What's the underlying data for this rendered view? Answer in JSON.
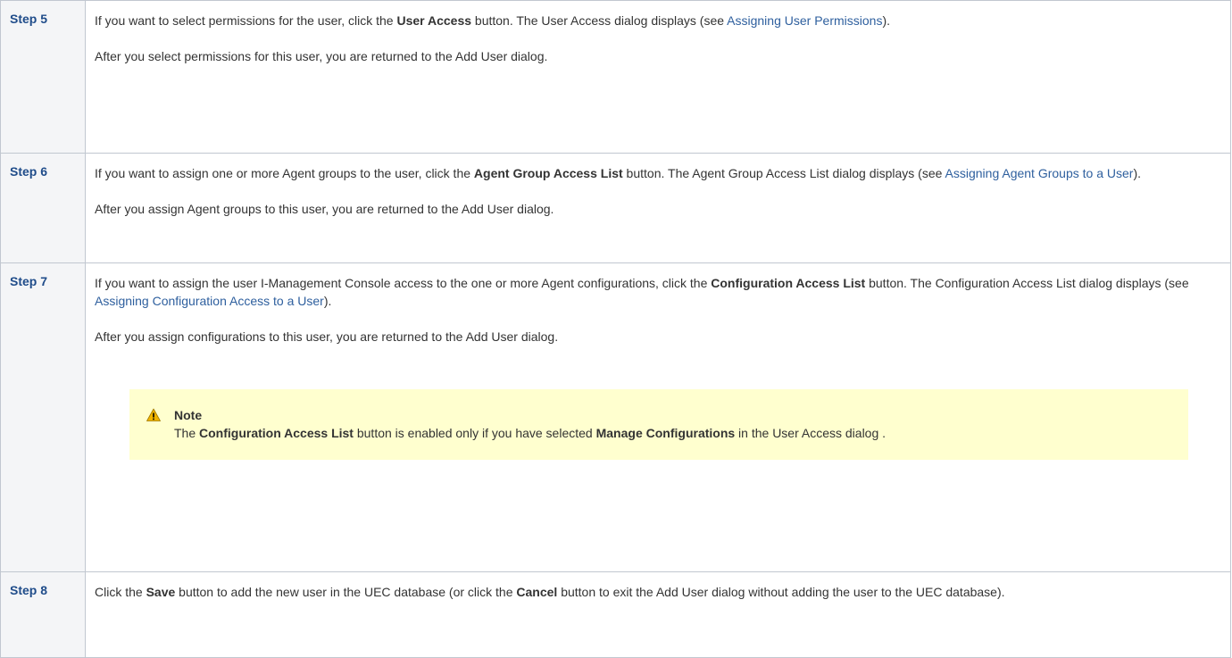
{
  "steps": [
    {
      "label": "Step 5",
      "p1": {
        "a": "If you want to select permissions for the user, click the ",
        "b": "User Access",
        "c": " button. The User Access dialog displays (see ",
        "link": "Assigning User Permissions",
        "d": ")."
      },
      "p2": "After you select permissions for this user, you are returned to the Add User dialog."
    },
    {
      "label": "Step 6",
      "p1": {
        "a": "If you want to assign one or more Agent groups to the user, click the ",
        "b": "Agent Group Access List",
        "c": " button. The Agent Group Access List dialog displays (see ",
        "link": "Assigning Agent Groups to a User",
        "d": ")."
      },
      "p2": "After you assign Agent groups to this user, you are returned to the Add User dialog."
    },
    {
      "label": "Step 7",
      "p1": {
        "a": "If you want to assign the user I-Management Console access to the one or more Agent configurations, click the ",
        "b": "Configuration Access List",
        "c": " button. The Configuration Access List dialog displays (see ",
        "link": "Assigning Configuration Access to a User",
        "d": ")."
      },
      "p2": "After you assign configurations to this user, you are returned to the Add User dialog.",
      "note": {
        "title": "Note",
        "a": "The ",
        "b1": "Configuration Access List",
        "c": " button is enabled only if you have selected ",
        "b2": "Manage Configurations",
        "d": " in the User Access dialog ."
      }
    },
    {
      "label": "Step 8",
      "p1": {
        "a": "Click the ",
        "b1": "Save",
        "c": " button to add the new user in the UEC database (or click the ",
        "b2": "Cancel",
        "d": " button to exit the Add User dialog without adding the user to the UEC database)."
      }
    }
  ],
  "colors": {
    "step_label": "#1f4c8a",
    "link": "#2e5f9e",
    "note_bg": "#ffffcf",
    "warning_icon": "#f0b400"
  },
  "icons": {
    "note": "warning-icon"
  }
}
